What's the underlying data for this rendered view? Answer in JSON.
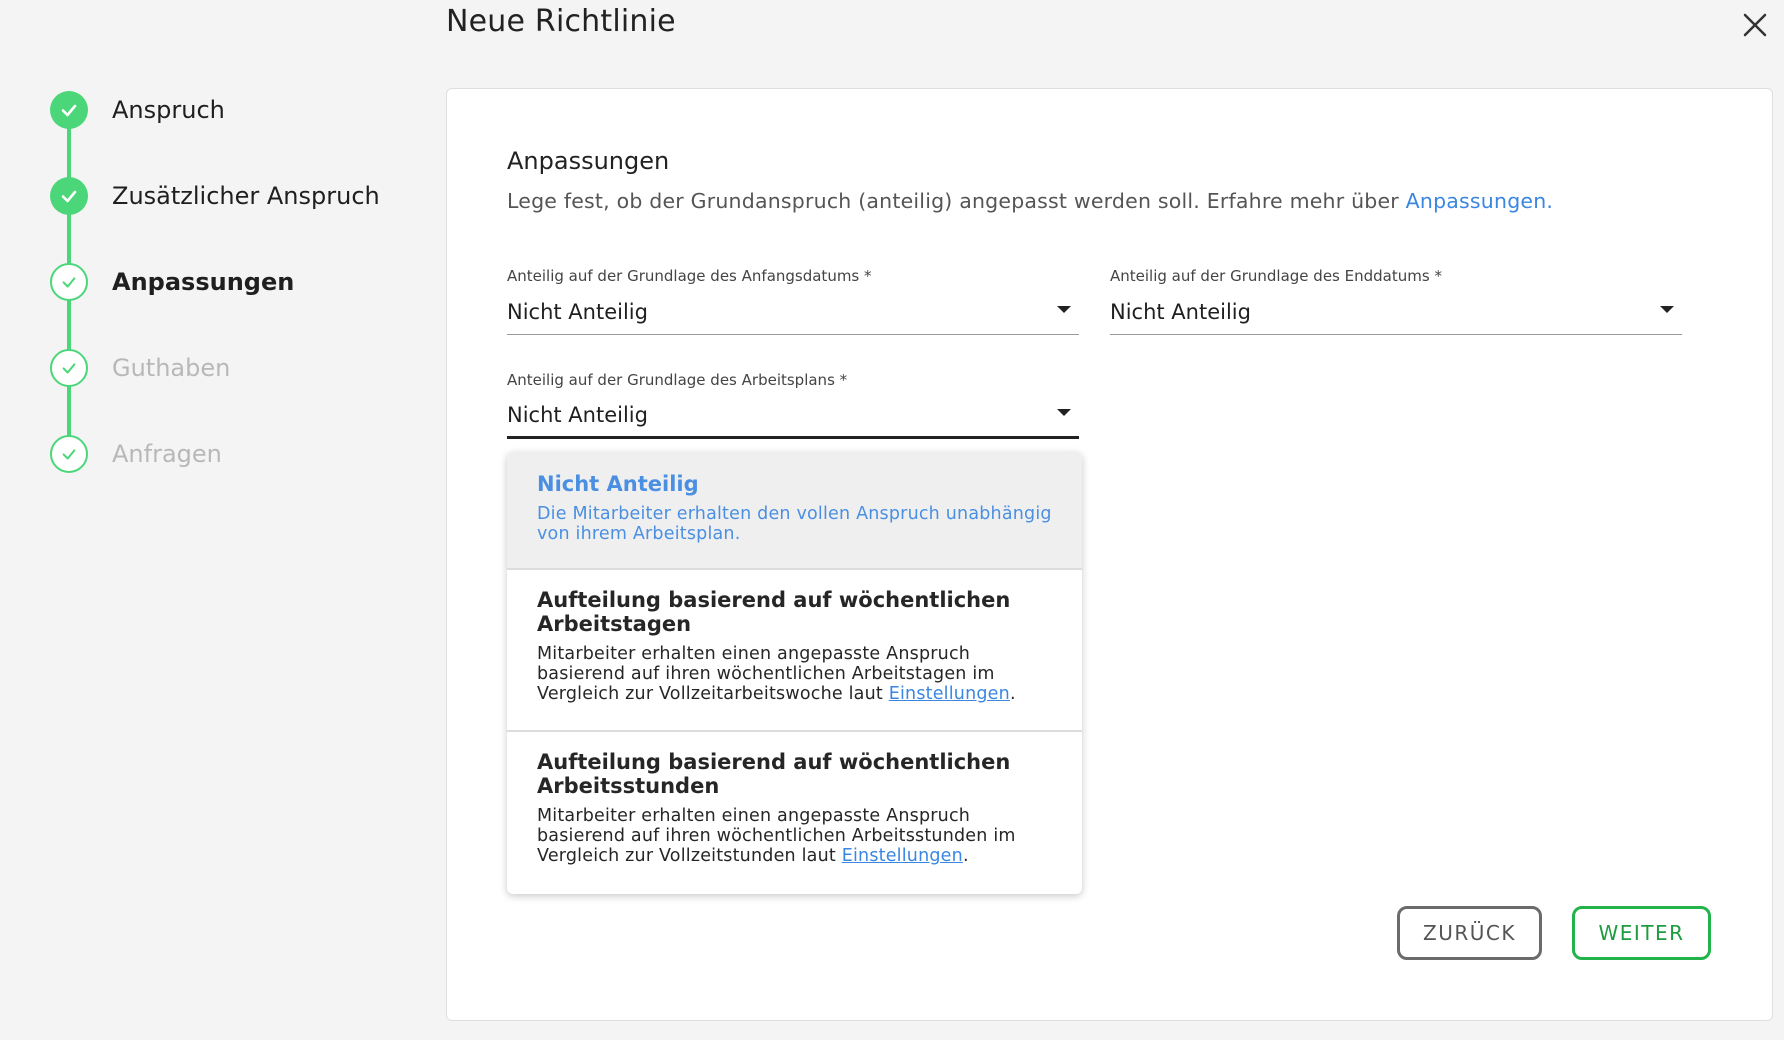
{
  "dialog": {
    "title": "Neue Richtlinie"
  },
  "stepper": {
    "steps": [
      {
        "label": "Anspruch",
        "state": "done"
      },
      {
        "label": "Zusätzlicher Anspruch",
        "state": "done"
      },
      {
        "label": "Anpassungen",
        "state": "active"
      },
      {
        "label": "Guthaben",
        "state": "todo"
      },
      {
        "label": "Anfragen",
        "state": "todo"
      }
    ]
  },
  "section": {
    "title": "Anpassungen",
    "description": "Lege fest, ob der Grundanspruch (anteilig) angepasst werden soll. Erfahre mehr über ",
    "link_text": "Anpassungen."
  },
  "fields": {
    "start_date": {
      "label": "Anteilig auf der Grundlage des Anfangsdatums *",
      "value": "Nicht Anteilig"
    },
    "end_date": {
      "label": "Anteilig auf der Grundlage des Enddatums *",
      "value": "Nicht Anteilig"
    },
    "work_schedule": {
      "label": "Anteilig auf der Grundlage des Arbeitsplans *",
      "value": "Nicht Anteilig"
    }
  },
  "menu": {
    "options": [
      {
        "title": "Nicht Anteilig",
        "desc_line1": "Die Mitarbeiter erhalten den vollen Anspruch unabhängig",
        "desc_line2": "von ihrem Arbeitsplan."
      },
      {
        "title_line1": "Aufteilung basierend auf wöchentlichen",
        "title_line2": "Arbeitstagen",
        "desc_line1": "Mitarbeiter erhalten einen angepasste Anspruch",
        "desc_line2": "basierend auf ihren wöchentlichen Arbeitstagen im",
        "desc_line3": "Vergleich zur Vollzeitarbeitswoche laut ",
        "link": "Einstellungen",
        "suffix": "."
      },
      {
        "title_line1": "Aufteilung basierend auf wöchentlichen",
        "title_line2": "Arbeitsstunden",
        "desc_line1": "Mitarbeiter erhalten einen angepasste Anspruch",
        "desc_line2": "basierend auf ihren wöchentlichen Arbeitsstunden im",
        "desc_line3": "Vergleich zur Vollzeitstunden laut ",
        "link": "Einstellungen",
        "suffix": "."
      }
    ]
  },
  "buttons": {
    "back": "ZURÜCK",
    "next": "WEITER"
  },
  "colors": {
    "accent_green": "#4cd67a",
    "button_green": "#22b44b",
    "link_blue": "#3a86e0"
  }
}
